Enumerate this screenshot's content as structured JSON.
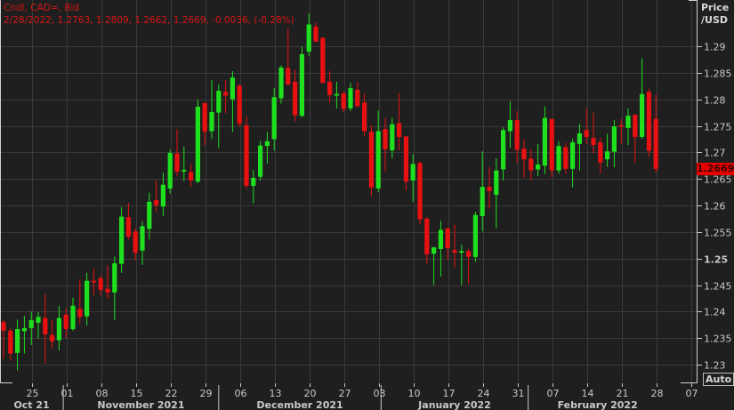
{
  "header": {
    "line1": "Cndl, CAD=, Bid",
    "line2": "2/28/2022, 1.2763, 1.2809, 1.2662, 1.2669, -0.0036, (-0.28%)"
  },
  "axis": {
    "unit_line1": "Price",
    "unit_line2": "/USD",
    "last_price": "1.2669",
    "auto_label": "Auto"
  },
  "colors": {
    "up": "#1ee01e",
    "down": "#e81010",
    "background": "#1f1f1f",
    "grid": "#3a3a3a",
    "header": "#d81414"
  },
  "chart_data": {
    "type": "candlestick",
    "title": "Cndl, CAD=, Bid",
    "ylabel": "Price /USD",
    "ylim": [
      1.2265,
      1.2985
    ],
    "yticks": [
      "1.23",
      "1.235",
      "1.24",
      "1.245",
      "1.25",
      "1.255",
      "1.26",
      "1.265",
      "1.27",
      "1.275",
      "1.28",
      "1.285",
      "1.29"
    ],
    "grid": true,
    "xticks": [
      {
        "label": "25",
        "index": 4
      },
      {
        "label": "01",
        "index": 9
      },
      {
        "label": "08",
        "index": 14
      },
      {
        "label": "15",
        "index": 19
      },
      {
        "label": "22",
        "index": 24
      },
      {
        "label": "29",
        "index": 29
      },
      {
        "label": "06",
        "index": 34
      },
      {
        "label": "13",
        "index": 39
      },
      {
        "label": "20",
        "index": 44
      },
      {
        "label": "27",
        "index": 49
      },
      {
        "label": "03",
        "index": 54
      },
      {
        "label": "10",
        "index": 59
      },
      {
        "label": "17",
        "index": 64
      },
      {
        "label": "24",
        "index": 69
      },
      {
        "label": "31",
        "index": 74
      },
      {
        "label": "07",
        "index": 79
      },
      {
        "label": "14",
        "index": 84
      },
      {
        "label": "21",
        "index": 89
      },
      {
        "label": "28",
        "index": 94
      },
      {
        "label": "07",
        "index": 99
      }
    ],
    "months": [
      {
        "label": "Oct 21",
        "start": -0.5,
        "end": 8.6
      },
      {
        "label": "November 2021",
        "start": 8.6,
        "end": 31
      },
      {
        "label": "December 2021",
        "start": 31,
        "end": 54.4
      },
      {
        "label": "January 2022",
        "start": 54.4,
        "end": 75.6
      },
      {
        "label": "February 2022",
        "start": 75.6,
        "end": 95.6
      }
    ],
    "ohlc": [
      [
        1.238,
        1.2384,
        1.2311,
        1.2364
      ],
      [
        1.2364,
        1.237,
        1.2307,
        1.2321
      ],
      [
        1.2322,
        1.2385,
        1.2289,
        1.2367
      ],
      [
        1.2363,
        1.2392,
        1.2321,
        1.2369
      ],
      [
        1.2369,
        1.24,
        1.2337,
        1.2384
      ],
      [
        1.2379,
        1.2399,
        1.2349,
        1.239
      ],
      [
        1.2388,
        1.2433,
        1.2302,
        1.2357
      ],
      [
        1.2356,
        1.2384,
        1.2331,
        1.2344
      ],
      [
        1.2346,
        1.2411,
        1.2327,
        1.2388
      ],
      [
        1.2394,
        1.2406,
        1.235,
        1.2367
      ],
      [
        1.2367,
        1.2426,
        1.2364,
        1.2411
      ],
      [
        1.2405,
        1.2461,
        1.2377,
        1.239
      ],
      [
        1.2391,
        1.2473,
        1.2374,
        1.2458
      ],
      [
        1.2458,
        1.2481,
        1.2431,
        1.2455
      ],
      [
        1.2463,
        1.2468,
        1.243,
        1.2441
      ],
      [
        1.2443,
        1.2487,
        1.2424,
        1.2436
      ],
      [
        1.2436,
        1.2504,
        1.2384,
        1.2491
      ],
      [
        1.249,
        1.2597,
        1.2473,
        1.2579
      ],
      [
        1.2578,
        1.2605,
        1.2536,
        1.2541
      ],
      [
        1.2551,
        1.2558,
        1.2497,
        1.2511
      ],
      [
        1.2515,
        1.257,
        1.2488,
        1.2561
      ],
      [
        1.2556,
        1.2624,
        1.2536,
        1.2607
      ],
      [
        1.261,
        1.2647,
        1.2589,
        1.26
      ],
      [
        1.2598,
        1.2662,
        1.258,
        1.2639
      ],
      [
        1.2632,
        1.2705,
        1.2622,
        1.2699
      ],
      [
        1.2698,
        1.2744,
        1.2656,
        1.2664
      ],
      [
        1.2664,
        1.2711,
        1.2646,
        1.2667
      ],
      [
        1.2663,
        1.2679,
        1.2635,
        1.2647
      ],
      [
        1.2645,
        1.28,
        1.2642,
        1.2786
      ],
      [
        1.2793,
        1.2793,
        1.2713,
        1.2739
      ],
      [
        1.274,
        1.2836,
        1.2725,
        1.2776
      ],
      [
        1.2775,
        1.2828,
        1.2708,
        1.2816
      ],
      [
        1.2814,
        1.2836,
        1.2774,
        1.2807
      ],
      [
        1.28,
        1.2853,
        1.2739,
        1.2841
      ],
      [
        1.2826,
        1.2828,
        1.2748,
        1.2754
      ],
      [
        1.2751,
        1.2768,
        1.2631,
        1.2637
      ],
      [
        1.2637,
        1.2667,
        1.2604,
        1.2652
      ],
      [
        1.2654,
        1.2722,
        1.2647,
        1.2713
      ],
      [
        1.2712,
        1.2739,
        1.2679,
        1.2721
      ],
      [
        1.2725,
        1.2821,
        1.2703,
        1.2804
      ],
      [
        1.2802,
        1.2864,
        1.2792,
        1.286
      ],
      [
        1.2859,
        1.2934,
        1.2826,
        1.2828
      ],
      [
        1.2833,
        1.2856,
        1.2758,
        1.277
      ],
      [
        1.2769,
        1.2899,
        1.2766,
        1.2885
      ],
      [
        1.289,
        1.2962,
        1.2881,
        1.2941
      ],
      [
        1.2937,
        1.2945,
        1.2907,
        1.2909
      ],
      [
        1.2916,
        1.2917,
        1.283,
        1.2831
      ],
      [
        1.2833,
        1.2853,
        1.2794,
        1.2808
      ],
      [
        1.2807,
        1.2833,
        1.2783,
        1.281
      ],
      [
        1.2811,
        1.2815,
        1.2776,
        1.2782
      ],
      [
        1.2783,
        1.2831,
        1.2778,
        1.2821
      ],
      [
        1.2818,
        1.2833,
        1.2785,
        1.2787
      ],
      [
        1.2794,
        1.2811,
        1.2731,
        1.274
      ],
      [
        1.2739,
        1.2751,
        1.2618,
        1.2634
      ],
      [
        1.2632,
        1.2779,
        1.2625,
        1.274
      ],
      [
        1.2744,
        1.2765,
        1.2664,
        1.2706
      ],
      [
        1.2704,
        1.2765,
        1.2689,
        1.2753
      ],
      [
        1.2755,
        1.2812,
        1.2704,
        1.2729
      ],
      [
        1.273,
        1.273,
        1.2628,
        1.2645
      ],
      [
        1.2647,
        1.2697,
        1.2607,
        1.2678
      ],
      [
        1.268,
        1.2683,
        1.2564,
        1.2574
      ],
      [
        1.2575,
        1.2578,
        1.2491,
        1.2508
      ],
      [
        1.2509,
        1.2522,
        1.245,
        1.2521
      ],
      [
        1.2518,
        1.2571,
        1.2466,
        1.2554
      ],
      [
        1.2557,
        1.2558,
        1.2498,
        1.252
      ],
      [
        1.2516,
        1.2564,
        1.2483,
        1.2511
      ],
      [
        1.2511,
        1.2526,
        1.245,
        1.2514
      ],
      [
        1.2514,
        1.2518,
        1.2452,
        1.2503
      ],
      [
        1.2503,
        1.2588,
        1.2494,
        1.2582
      ],
      [
        1.258,
        1.2702,
        1.2551,
        1.2635
      ],
      [
        1.2635,
        1.2672,
        1.2594,
        1.2627
      ],
      [
        1.262,
        1.2689,
        1.2557,
        1.2666
      ],
      [
        1.2668,
        1.2747,
        1.2647,
        1.2742
      ],
      [
        1.274,
        1.2796,
        1.2709,
        1.2761
      ],
      [
        1.2761,
        1.2778,
        1.268,
        1.2705
      ],
      [
        1.2707,
        1.2725,
        1.2652,
        1.2687
      ],
      [
        1.2688,
        1.2705,
        1.2647,
        1.2666
      ],
      [
        1.2668,
        1.2716,
        1.2655,
        1.2677
      ],
      [
        1.2675,
        1.2787,
        1.2659,
        1.2765
      ],
      [
        1.2763,
        1.2763,
        1.2653,
        1.2666
      ],
      [
        1.2666,
        1.2721,
        1.266,
        1.2712
      ],
      [
        1.271,
        1.2718,
        1.266,
        1.2669
      ],
      [
        1.2669,
        1.2725,
        1.2634,
        1.2719
      ],
      [
        1.2716,
        1.2754,
        1.2666,
        1.2736
      ],
      [
        1.2742,
        1.2782,
        1.2716,
        1.2729
      ],
      [
        1.2727,
        1.2775,
        1.2698,
        1.2714
      ],
      [
        1.2719,
        1.2727,
        1.266,
        1.2681
      ],
      [
        1.2687,
        1.2735,
        1.2673,
        1.2702
      ],
      [
        1.2701,
        1.2761,
        1.2672,
        1.2749
      ],
      [
        1.2751,
        1.2763,
        1.2716,
        1.275
      ],
      [
        1.2746,
        1.2783,
        1.2714,
        1.2769
      ],
      [
        1.2771,
        1.2772,
        1.268,
        1.2729
      ],
      [
        1.2729,
        1.2877,
        1.2725,
        1.281
      ],
      [
        1.2814,
        1.282,
        1.2692,
        1.2703
      ],
      [
        1.2763,
        1.2809,
        1.2662,
        1.2669
      ]
    ]
  }
}
